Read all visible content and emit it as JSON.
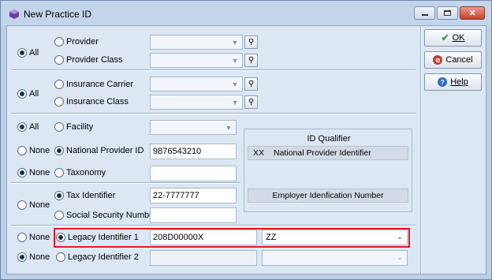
{
  "window": {
    "title": "New Practice ID"
  },
  "sections": {
    "provider": {
      "scope_label": "All",
      "provider_label": "Provider",
      "provider_class_label": "Provider Class"
    },
    "insurance": {
      "scope_label": "All",
      "carrier_label": "Insurance Carrier",
      "class_label": "Insurance Class"
    },
    "facility": {
      "all_label": "All",
      "facility_label": "Facility"
    },
    "npi": {
      "none_label": "None",
      "label": "National Provider ID",
      "value": "9876543210"
    },
    "taxonomy": {
      "none_label": "None",
      "label": "Taxonomy",
      "value": ""
    },
    "tax": {
      "none_label": "None",
      "tax_label": "Tax Identifier",
      "tax_value": "22-7777777",
      "ssn_label": "Social Security Number",
      "ssn_value": ""
    },
    "legacy1": {
      "none_label": "None",
      "label": "Legacy Identifier 1",
      "value": "208D00000X",
      "qualifier": "ZZ"
    },
    "legacy2": {
      "none_label": "None",
      "label": "Legacy Identifier 2",
      "value": "",
      "qualifier": ""
    }
  },
  "id_qualifier": {
    "title": "ID Qualifier",
    "row1_code": "XX",
    "row1_desc": "National Provider Identifier",
    "row2_desc": "Employer Idenfication Number"
  },
  "buttons": {
    "ok": "OK",
    "cancel": "Cancel",
    "help": "Help"
  },
  "colors": {
    "highlight": "#dd1d26",
    "ok_icon": "#3aa03a",
    "cancel_icon": "#c0392b",
    "help_icon": "#2f6fc0"
  },
  "icons": [
    "app-icon",
    "minimize-icon",
    "maximize-icon",
    "close-icon",
    "chevron-down-icon",
    "lookup-icon",
    "checkmark-icon",
    "cancel-icon",
    "help-icon"
  ]
}
